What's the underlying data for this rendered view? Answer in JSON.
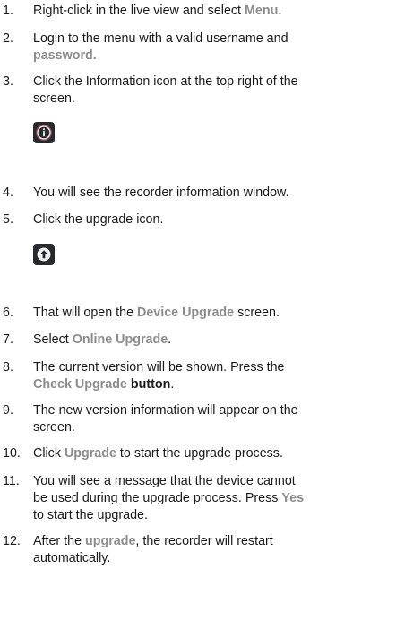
{
  "steps": [
    {
      "num": "1.",
      "before": "Right-click in the live view and select ",
      "hl": "Menu."
    },
    {
      "num": "2.",
      "line1": "Login to the menu with a valid username and",
      "hl": "password."
    },
    {
      "num": "3.",
      "line1": "Click the Information icon at the top right of the",
      "line2": "screen."
    },
    {
      "num": "4.",
      "text": "You will see the recorder information window."
    },
    {
      "num": "5.",
      "text": "Click the upgrade icon."
    },
    {
      "num": "6.",
      "before": "That will open the ",
      "hl": "Device Upgrade",
      "after": " screen."
    },
    {
      "num": "7.",
      "before": "Select ",
      "hl": "Online Upgrade",
      "after": "."
    },
    {
      "num": "8.",
      "line1": "The current version will be shown. Press the",
      "hl": "Check Upgrade",
      "bold": "button",
      "after": "."
    },
    {
      "num": "9.",
      "line1": "The new version information will appear on the",
      "line2": "screen."
    },
    {
      "num": "10.",
      "before": "Click ",
      "hl": "Upgrade",
      "after": " to start the upgrade process."
    },
    {
      "num": "11.",
      "line1": "You will see a message that the device cannot",
      "line2_before": "be used during the upgrade process. Press ",
      "hl": "Yes",
      "line3": "to start the upgrade."
    },
    {
      "num": "12.",
      "line1_before": "After the ",
      "hl": "upgrade",
      "line1_after": ", the recorder will restart",
      "line2": "automatically."
    }
  ],
  "icons": {
    "info": "info-icon",
    "upgrade": "upgrade-arrow-icon"
  },
  "colors": {
    "text": "#1a1a1a",
    "highlight": "#8c8c8c",
    "icon_bg": "#26292e",
    "info_ring": "#d14a4a"
  }
}
